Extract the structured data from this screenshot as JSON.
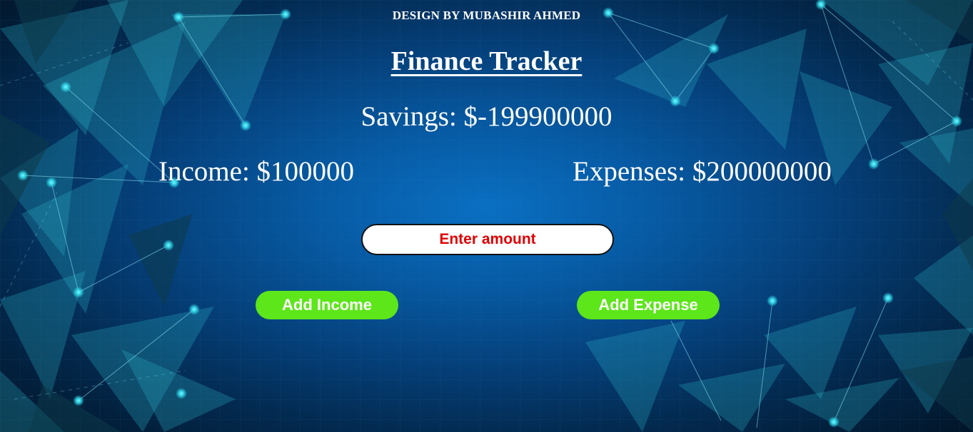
{
  "credit": "DESIGN BY MUBASHIR AHMED",
  "title": "Finance Tracker",
  "savings": "Savings: $-199900000",
  "income": "Income: $100000",
  "expenses": "Expenses: $200000000",
  "amount_input": {
    "placeholder": "Enter amount",
    "value": ""
  },
  "buttons": {
    "add_income": "Add Income",
    "add_expense": "Add Expense"
  },
  "colors": {
    "background": "#0a6fc2",
    "button": "#5de61a",
    "placeholder": "#e00000",
    "text": "#ffffff"
  }
}
